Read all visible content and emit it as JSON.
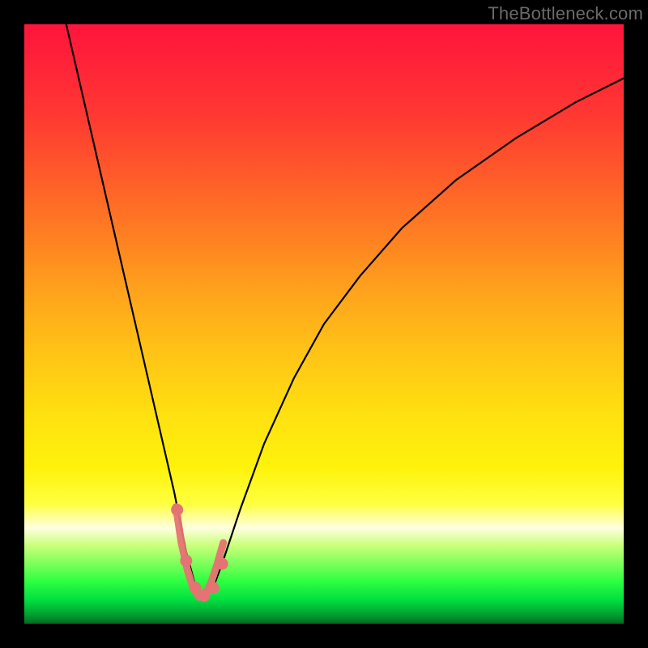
{
  "watermark": "TheBottleneck.com",
  "chart_data": {
    "type": "line",
    "title": "",
    "xlabel": "",
    "ylabel": "",
    "xlim": [
      0,
      100
    ],
    "ylim": [
      0,
      100
    ],
    "series": [
      {
        "name": "bottleneck-curve",
        "x": [
          7,
          10,
          13,
          16,
          19,
          22,
          25,
          27,
          28.5,
          30,
          31.5,
          33,
          36,
          40,
          45,
          50,
          56,
          63,
          72,
          82,
          92,
          100
        ],
        "values": [
          100,
          87,
          74,
          61,
          48,
          35,
          22,
          12,
          6.5,
          4.5,
          6,
          10,
          19,
          30,
          41,
          50,
          58,
          66,
          74,
          81,
          87,
          91
        ]
      }
    ],
    "markers": {
      "name": "highlight-points",
      "color": "#e57373",
      "x": [
        25.5,
        27,
        28.5,
        30,
        31.5,
        33
      ],
      "values": [
        19,
        10.5,
        6,
        4.7,
        6,
        10
      ]
    },
    "trough_curve": {
      "name": "trough-outline",
      "color": "#e57373",
      "x": [
        25.3,
        26.2,
        27.2,
        28.2,
        29.2,
        30.2,
        31.2,
        32.2,
        33.2
      ],
      "values": [
        19.5,
        13.5,
        9,
        5.8,
        4.4,
        5.0,
        7.0,
        10.0,
        13.5
      ]
    },
    "background_gradient": [
      {
        "stop": 0,
        "color": "#ff153b"
      },
      {
        "stop": 25,
        "color": "#ff5a2a"
      },
      {
        "stop": 50,
        "color": "#ffb418"
      },
      {
        "stop": 75,
        "color": "#fef30b"
      },
      {
        "stop": 88,
        "color": "#9cff64"
      },
      {
        "stop": 100,
        "color": "#006a22"
      }
    ]
  }
}
